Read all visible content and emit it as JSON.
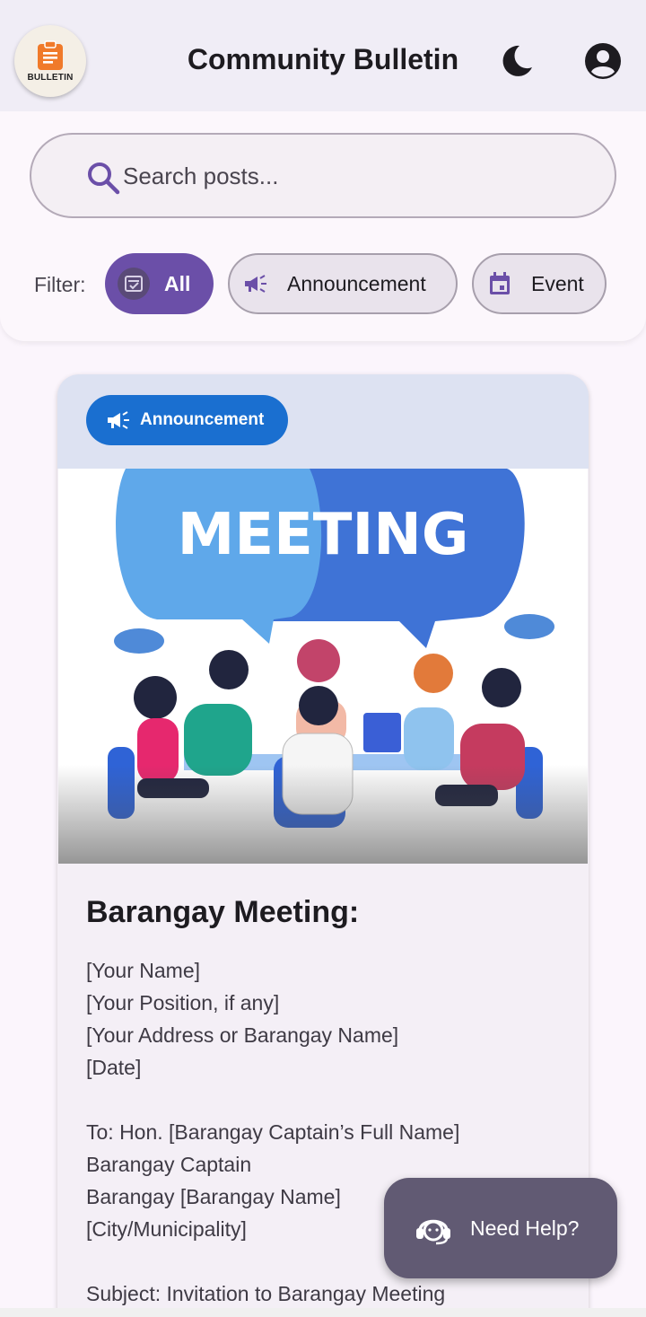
{
  "app": {
    "logo_text": "BULLETIN",
    "title": "Community Bulletin",
    "theme_icon": "moon-icon",
    "account_icon": "account-circle-icon"
  },
  "search": {
    "placeholder": "Search posts...",
    "value": ""
  },
  "filters": {
    "label": "Filter:",
    "chips": [
      {
        "label": "All",
        "icon": "filter-all-icon",
        "selected": true
      },
      {
        "label": "Announcement",
        "icon": "megaphone-icon",
        "selected": false
      },
      {
        "label": "Event",
        "icon": "calendar-icon",
        "selected": false
      }
    ]
  },
  "post": {
    "badge": "Announcement",
    "badge_color": "#1a6fd0",
    "image_headline": "MEETING",
    "title": "Barangay Meeting:",
    "body_lines": [
      "[Your Name]",
      "[Your Position, if any]",
      "[Your Address or Barangay Name]",
      "[Date]",
      "",
      "To: Hon. [Barangay Captain’s Full Name]",
      "Barangay Captain",
      "Barangay [Barangay Name]",
      "[City/Municipality]",
      "",
      "Subject: Invitation to Barangay Meeting"
    ]
  },
  "help": {
    "label": "Need Help?",
    "icon": "support-agent-icon"
  },
  "colors": {
    "primary": "#6b4fa8",
    "appbar_bg": "#f0edf6",
    "fab_bg": "#615a73"
  }
}
